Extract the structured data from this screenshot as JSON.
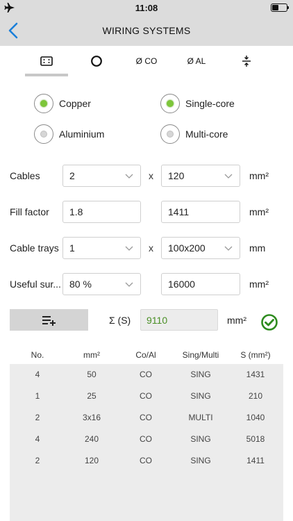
{
  "status_bar": {
    "time": "11:08"
  },
  "nav": {
    "title": "WIRING SYSTEMS"
  },
  "tabs": [
    {
      "icon": "rectangle-dots-icon",
      "label": ""
    },
    {
      "icon": "circle-icon",
      "label": ""
    },
    {
      "icon": "",
      "label": "Ø CO"
    },
    {
      "icon": "",
      "label": "Ø AL"
    },
    {
      "icon": "compress-arrows-icon",
      "label": ""
    }
  ],
  "active_tab": 0,
  "radios": {
    "copper": {
      "label": "Copper",
      "selected": true
    },
    "aluminium": {
      "label": "Aluminium",
      "selected": false
    },
    "single_core": {
      "label": "Single-core",
      "selected": true
    },
    "multi_core": {
      "label": "Multi-core",
      "selected": false
    }
  },
  "form": {
    "cables": {
      "label": "Cables",
      "count": "2",
      "separator": "x",
      "section": "120",
      "unit": "mm²"
    },
    "fill_factor": {
      "label": "Fill factor",
      "value": "1.8",
      "result": "1411",
      "unit": "mm²"
    },
    "cable_trays": {
      "label": "Cable trays",
      "count": "1",
      "separator": "x",
      "size": "100x200",
      "unit": "mm"
    },
    "useful_surface": {
      "label": "Useful sur...",
      "percent": "80 %",
      "result": "16000",
      "unit": "mm²"
    }
  },
  "sum": {
    "label": "Σ (S)",
    "value": "9110",
    "unit": "mm²"
  },
  "colors": {
    "accent_green": "#7dc63a",
    "sum_green": "#4a8f26",
    "check_green": "#2e8b1f"
  },
  "table": {
    "headers": [
      "No.",
      "mm²",
      "Co/Al",
      "Sing/Multi",
      "S (mm²)"
    ],
    "rows": [
      [
        "4",
        "50",
        "CO",
        "SING",
        "1431"
      ],
      [
        "1",
        "25",
        "CO",
        "SING",
        "210"
      ],
      [
        "2",
        "3x16",
        "CO",
        "MULTI",
        "1040"
      ],
      [
        "4",
        "240",
        "CO",
        "SING",
        "5018"
      ],
      [
        "2",
        "120",
        "CO",
        "SING",
        "1411"
      ]
    ]
  }
}
